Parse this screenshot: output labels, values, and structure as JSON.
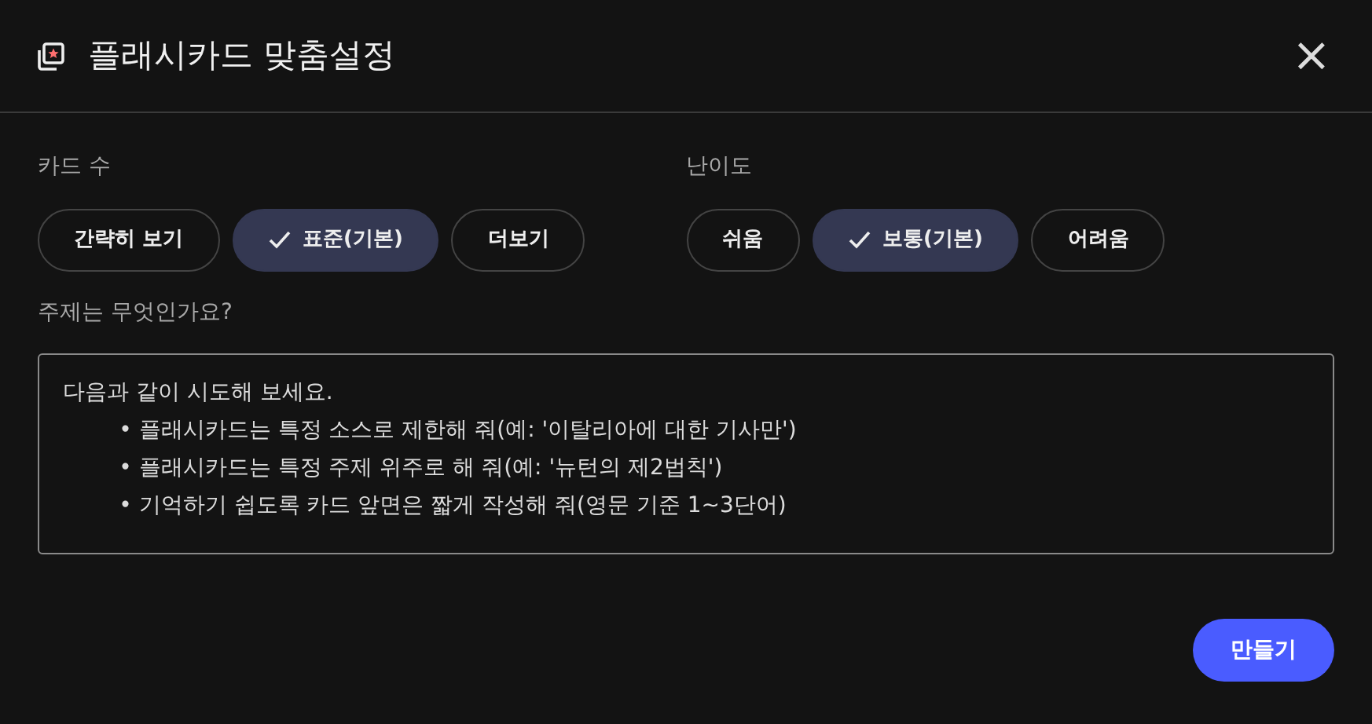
{
  "dialog": {
    "title": "플래시카드 맞춤설정",
    "close": "×"
  },
  "groups": [
    {
      "label": "카드 수",
      "options": [
        {
          "label": "간략히 보기",
          "selected": false
        },
        {
          "label": "표준(기본)",
          "selected": true
        },
        {
          "label": "더보기",
          "selected": false
        }
      ]
    },
    {
      "label": "난이도",
      "options": [
        {
          "label": "쉬움",
          "selected": false
        },
        {
          "label": "보통(기본)",
          "selected": true
        },
        {
          "label": "어려움",
          "selected": false
        }
      ]
    }
  ],
  "topic": {
    "label": "주제는 무엇인가요?",
    "placeholder": "다음과 같이 시도해 보세요.\n        • 플래시카드는 특정 소스로 제한해 줘(예: '이탈리아에 대한 기사만')\n        • 플래시카드는 특정 주제 위주로 해 줘(예: '뉴턴의 제2법칙')\n        • 기억하기 쉽도록 카드 앞면은 짧게 작성해 줘(영문 기준 1~3단어)"
  },
  "buttons": [
    "만들기"
  ]
}
